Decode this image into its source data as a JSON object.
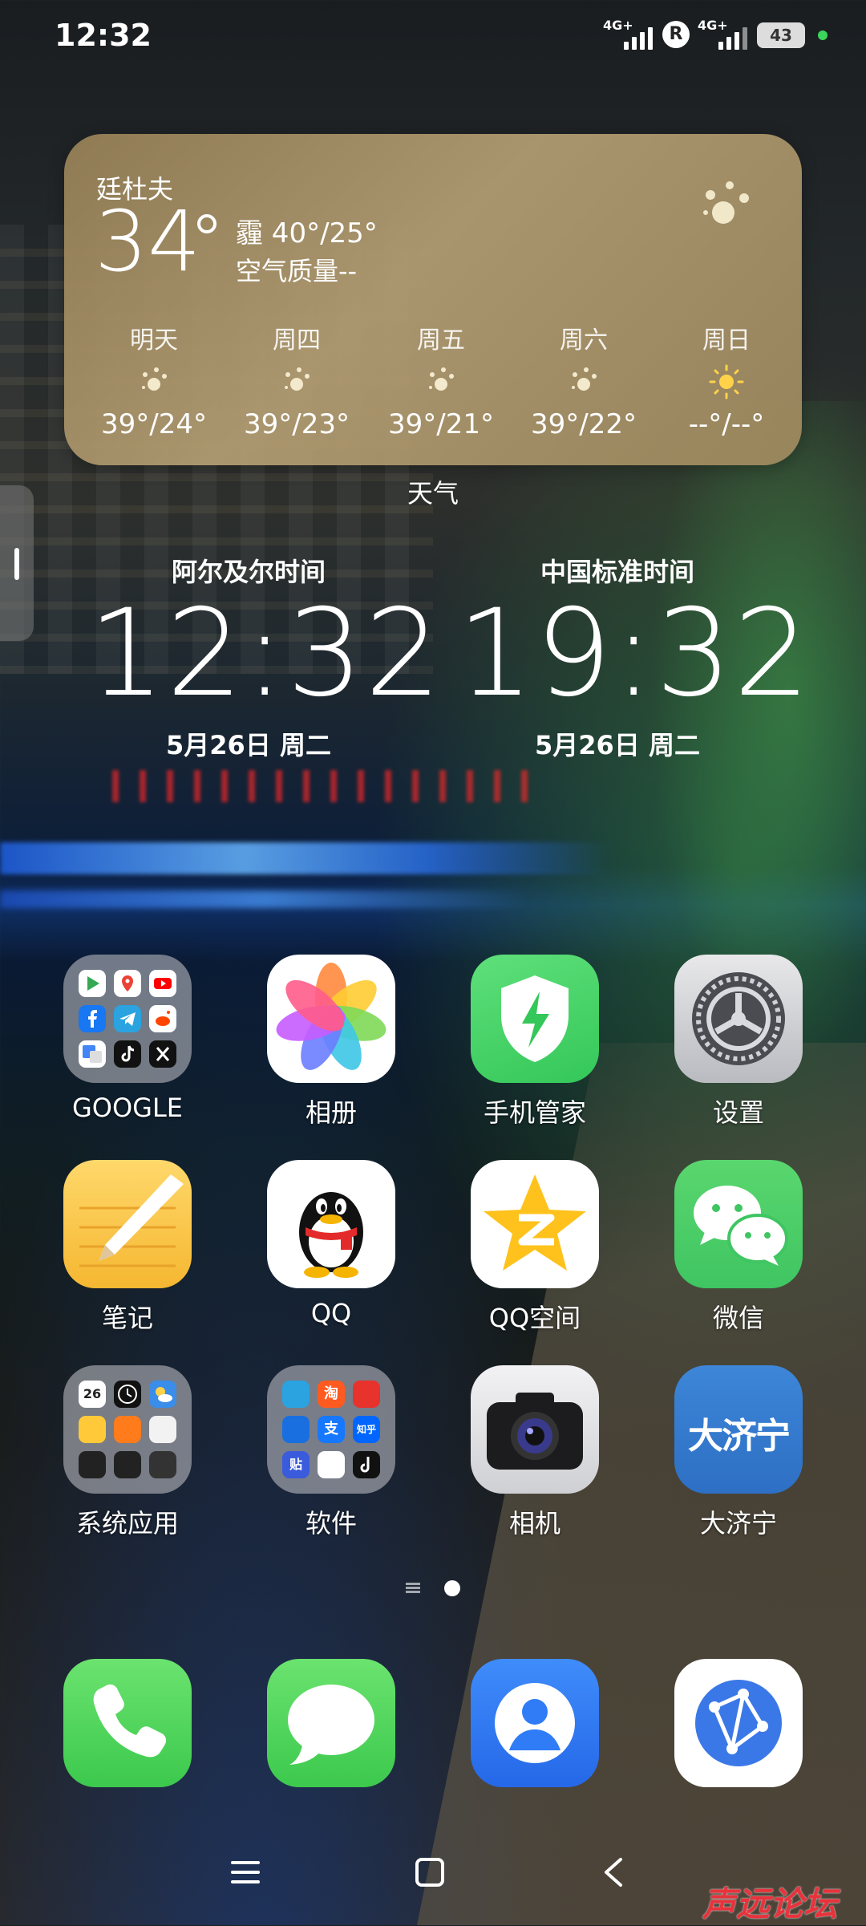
{
  "status_bar": {
    "time": "12:32",
    "signal1_label": "4G+",
    "signal2_label": "4G+",
    "roaming": "R",
    "battery": "43"
  },
  "weather": {
    "city": "廷杜夫",
    "temperature": "34",
    "condition": "霾 40°/25°",
    "air_quality": "空气质量--",
    "forecast": [
      {
        "day": "明天",
        "temp": "39°/24°",
        "icon": "sun-dust-icon"
      },
      {
        "day": "周四",
        "temp": "39°/23°",
        "icon": "sun-dust-icon"
      },
      {
        "day": "周五",
        "temp": "39°/21°",
        "icon": "sun-dust-icon"
      },
      {
        "day": "周六",
        "temp": "39°/22°",
        "icon": "sun-dust-icon"
      },
      {
        "day": "周日",
        "temp": "--°/--°",
        "icon": "sun-icon"
      }
    ],
    "widget_label": "天气"
  },
  "clocks": [
    {
      "label": "阿尔及尔时间",
      "time": "12:32",
      "date": "5月26日 周二"
    },
    {
      "label": "中国标准时间",
      "time": "19:32",
      "date": "5月26日 周二"
    }
  ],
  "apps": [
    {
      "name": "GOOGLE"
    },
    {
      "name": "相册"
    },
    {
      "name": "手机管家"
    },
    {
      "name": "设置"
    },
    {
      "name": "笔记"
    },
    {
      "name": "QQ"
    },
    {
      "name": "QQ空间"
    },
    {
      "name": "微信"
    },
    {
      "name": "系统应用"
    },
    {
      "name": "软件"
    },
    {
      "name": "相机"
    },
    {
      "name": "大济宁"
    }
  ],
  "folder_labels": {
    "system_date": "26",
    "software_a": "淘",
    "software_b": "支",
    "software_c": "知乎",
    "software_d": "贴"
  },
  "dajining_logo": "大济宁",
  "watermark": "声远论坛",
  "colors": {
    "weather_card": "#a08a5e",
    "phone_green": "#4cd964",
    "wechat_green": "#3fc562",
    "contacts_blue": "#2f7cf6",
    "security_green": "#34c759",
    "dajining_blue": "#2d6fc4"
  }
}
